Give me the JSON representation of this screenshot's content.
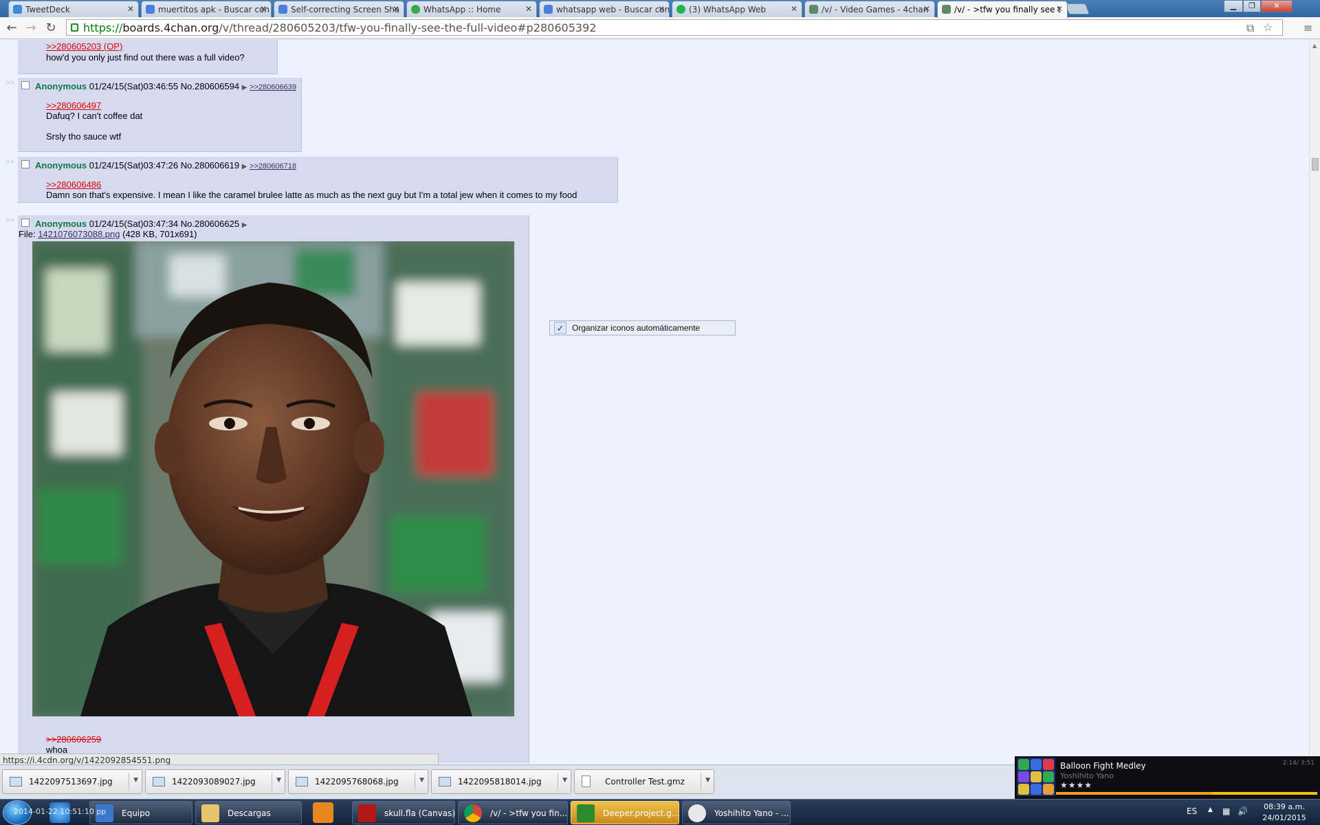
{
  "browser": {
    "tabs": [
      {
        "title": "TweetDeck",
        "color": "#3b8cd6"
      },
      {
        "title": "muertitos apk - Buscar con",
        "color": "#4a7fe0"
      },
      {
        "title": "Self-correcting Screen Sha",
        "color": "#4a7fe0"
      },
      {
        "title": "WhatsApp :: Home",
        "color": "#3aa84a"
      },
      {
        "title": "whatsapp web - Buscar con",
        "color": "#4a7fe0"
      },
      {
        "title": "(3) WhatsApp Web",
        "color": "#1eb84a"
      },
      {
        "title": "/v/ - Video Games - 4chan",
        "color": "#5d8a6a"
      },
      {
        "title": "/v/ - >tfw you finally see t",
        "color": "#5d8a6a"
      }
    ],
    "url_scheme": "https://",
    "url_host": "boards.4chan.org",
    "url_path": "/v/thread/280605203/tfw-you-finally-see-the-full-video#p280605392",
    "status_url": "https://i.4cdn.org/v/1422092854551.png"
  },
  "thread": {
    "top_quote": ">>280605203 (OP)",
    "top_text": "how'd you only just find out there was a full video?",
    "side_arrows": ">>",
    "posts": [
      {
        "name": "Anonymous",
        "datetime": "01/24/15(Sat)03:46:55",
        "number": "No.280606594",
        "arrow": "▶",
        "backlink": ">>280606639",
        "quote": ">>280606497",
        "line1": "Dafuq? I can't coffee dat",
        "line2": "Srsly tho sauce wtf"
      },
      {
        "name": "Anonymous",
        "datetime": "01/24/15(Sat)03:47:26",
        "number": "No.280606619",
        "arrow": "▶",
        "backlink": ">>280606718",
        "quote": ">>280606486",
        "line1": "Damn son that's expensive. I mean I like the caramel brulee latte as much as the next guy but I'm a total jew when it comes to my food"
      },
      {
        "name": "Anonymous",
        "datetime": "01/24/15(Sat)03:47:34",
        "number": "No.280606625",
        "arrow": "▶",
        "file_label": "File:",
        "file_name": "1421076073088.png",
        "file_meta": "(428 KB, 701x691)",
        "quote": ">>280606259",
        "line1": "whoa"
      }
    ]
  },
  "context_item": {
    "label": "Organizar iconos automáticamente",
    "checked_glyph": "✓"
  },
  "downloads": [
    {
      "name": "1422097513697.jpg"
    },
    {
      "name": "1422093089027.jpg"
    },
    {
      "name": "1422095768068.jpg"
    },
    {
      "name": "1422095818014.jpg"
    },
    {
      "name": "Controller Test.gmz"
    }
  ],
  "media_player": {
    "song": "Balloon Fight Medley",
    "artist": "Yoshihito Yano",
    "rating_stars": "★★★★",
    "time": "2:14/ 3:51",
    "progress": 0.6
  },
  "taskbar": {
    "tasks": [
      {
        "label": "Equipo"
      },
      {
        "label": "Descargas"
      },
      {
        "label": "skull.fla (Canvas)"
      },
      {
        "label": "/v/ - >tfw you fin..."
      },
      {
        "label": "Deeper.project.g..."
      },
      {
        "label": "Yoshihito Yano - ..."
      }
    ],
    "overlay_text": "2014-01-22 10:51:10 pp",
    "language": "ES",
    "clock_time": "08:39 a.m.",
    "clock_date": "24/01/2015"
  }
}
